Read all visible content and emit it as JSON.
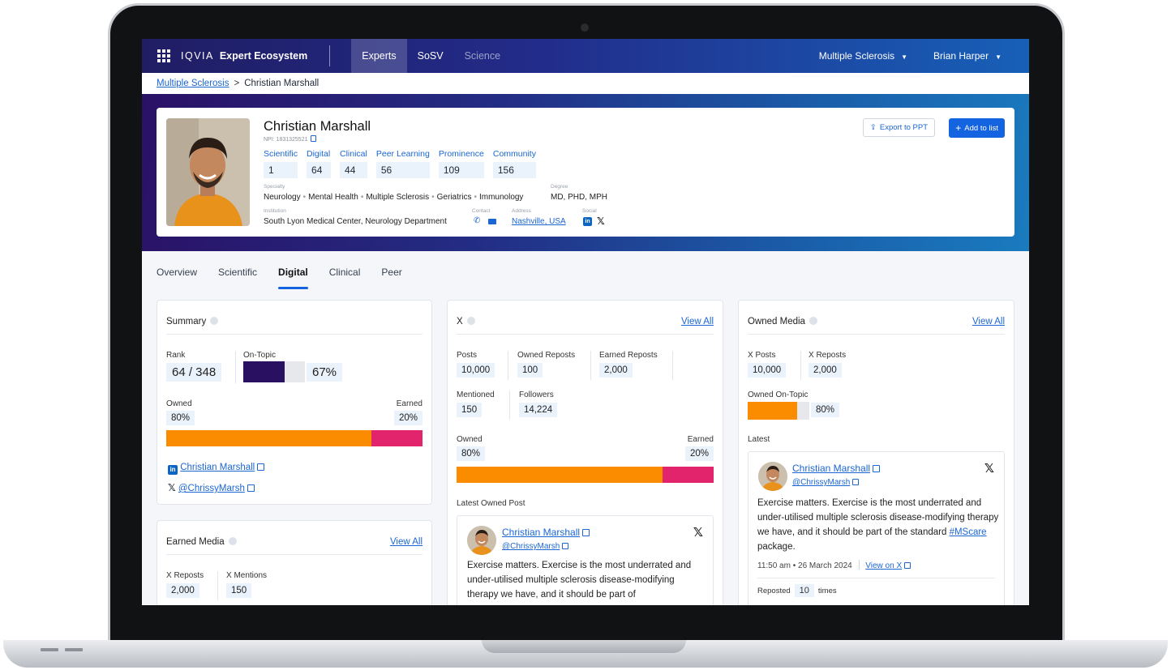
{
  "app": {
    "brand_logo": "IQVIA",
    "brand_name": "Expert Ecosystem"
  },
  "nav": {
    "tabs": [
      {
        "label": "Experts"
      },
      {
        "label": "SoSV"
      },
      {
        "label": "Science"
      }
    ],
    "therapy_area": "Multiple Sclerosis",
    "user": "Brian Harper"
  },
  "breadcrumb": {
    "parent": "Multiple Sclerosis",
    "separator": ">",
    "current": "Christian Marshall"
  },
  "profile": {
    "name": "Christian Marshall",
    "npi": "NPI: 1831325521",
    "scores": [
      {
        "label": "Scientific",
        "value": "1"
      },
      {
        "label": "Digital",
        "value": "64"
      },
      {
        "label": "Clinical",
        "value": "44"
      },
      {
        "label": "Peer Learning",
        "value": "56"
      },
      {
        "label": "Prominence",
        "value": "109"
      },
      {
        "label": "Community",
        "value": "156"
      }
    ],
    "specialty_label": "Specialty",
    "specialties": [
      "Neurology",
      "Mental Health",
      "Multiple Sclerosis",
      "Geriatrics",
      "Immunology"
    ],
    "degree_label": "Degree",
    "degree": "MD, PHD, MPH",
    "institution_label": "Institution",
    "institution": "South Lyon Medical Center, Neurology Department",
    "contact_label": "Contact",
    "address_label": "Address",
    "address": "Nashville, USA",
    "social_label": "Social",
    "export_label": "Export to PPT",
    "add_label": "Add to list"
  },
  "tabs": [
    {
      "label": "Overview"
    },
    {
      "label": "Scientific"
    },
    {
      "label": "Digital"
    },
    {
      "label": "Clinical"
    },
    {
      "label": "Peer"
    }
  ],
  "summary": {
    "title": "Summary",
    "rank_label": "Rank",
    "rank": "64 / 348",
    "on_topic_label": "On-Topic",
    "on_topic": "67%",
    "on_topic_fraction": 0.67,
    "owned_label": "Owned",
    "owned": "80%",
    "earned_label": "Earned",
    "earned": "20%",
    "owned_fraction": 0.8,
    "linkedin_name": "Christian Marshall",
    "x_handle": "@ChrissyMarsh"
  },
  "earned_media": {
    "title": "Earned Media",
    "view_all": "View All",
    "x_reposts_label": "X Reposts",
    "x_reposts": "2,000",
    "x_mentions_label": "X Mentions",
    "x_mentions": "150"
  },
  "x_card": {
    "title": "X",
    "view_all": "View All",
    "posts_label": "Posts",
    "posts": "10,000",
    "owned_reposts_label": "Owned Reposts",
    "owned_reposts": "100",
    "earned_reposts_label": "Earned Reposts",
    "earned_reposts": "2,000",
    "mentioned_label": "Mentioned",
    "mentioned": "150",
    "followers_label": "Followers",
    "followers": "14,224",
    "owned_label": "Owned",
    "owned": "80%",
    "earned_label": "Earned",
    "earned": "20%",
    "owned_fraction": 0.8,
    "latest_label": "Latest Owned Post",
    "post_author": "Christian Marshall",
    "post_handle": "@ChrissyMarsh",
    "post_text": "Exercise matters. Exercise is the most underrated and under-utilised multiple sclerosis disease-modifying therapy we have, and it should be part of"
  },
  "owned_media": {
    "title": "Owned Media",
    "view_all": "View All",
    "x_posts_label": "X Posts",
    "x_posts": "10,000",
    "x_reposts_label": "X Reposts",
    "x_reposts": "2,000",
    "on_topic_label": "Owned On-Topic",
    "on_topic": "80%",
    "on_topic_fraction": 0.8,
    "latest_label": "Latest",
    "post_author": "Christian Marshall",
    "post_handle": "@ChrissyMarsh",
    "post_text_before": "Exercise matters. Exercise is the most underrated and under-utilised multiple sclerosis disease-modifying therapy we have, and it should be part of the standard ",
    "post_hashtag": "#MScare",
    "post_text_after": " package.",
    "post_time": "11:50 am • 26 March 2024",
    "view_on_x": "View on X",
    "reposted_label": "Reposted",
    "reposted_count": "10",
    "reposted_suffix": "times"
  },
  "colors": {
    "accent": "#1463e0",
    "owned": "#fb8c00",
    "earned": "#e2246d",
    "on_topic": "#2a1060"
  }
}
